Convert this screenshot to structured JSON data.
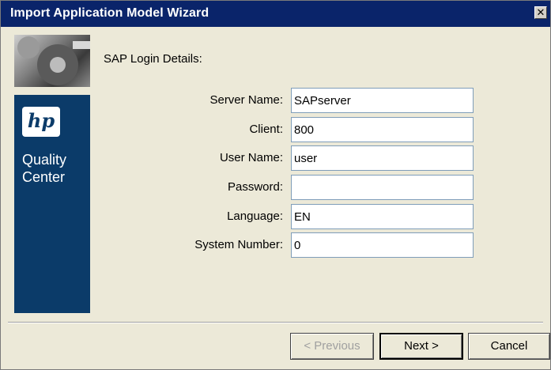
{
  "window": {
    "title": "Import Application Model Wizard",
    "close_glyph": "✕"
  },
  "banner": {
    "logo_text": "hp",
    "product_line1": "Quality",
    "product_line2": "Center"
  },
  "form": {
    "section_title": "SAP Login Details:",
    "fields": [
      {
        "label": "Server Name:",
        "value": "SAPserver"
      },
      {
        "label": "Client:",
        "value": "800"
      },
      {
        "label": "User Name:",
        "value": "user"
      },
      {
        "label": "Password:",
        "value": ""
      },
      {
        "label": "Language:",
        "value": "EN"
      },
      {
        "label": "System Number:",
        "value": "0"
      }
    ]
  },
  "buttons": {
    "previous": "< Previous",
    "next": "Next >",
    "cancel": "Cancel"
  },
  "colors": {
    "titlebar": "#0a246a",
    "banner_blue": "#0b3b69",
    "dialog_bg": "#ece9d8"
  }
}
